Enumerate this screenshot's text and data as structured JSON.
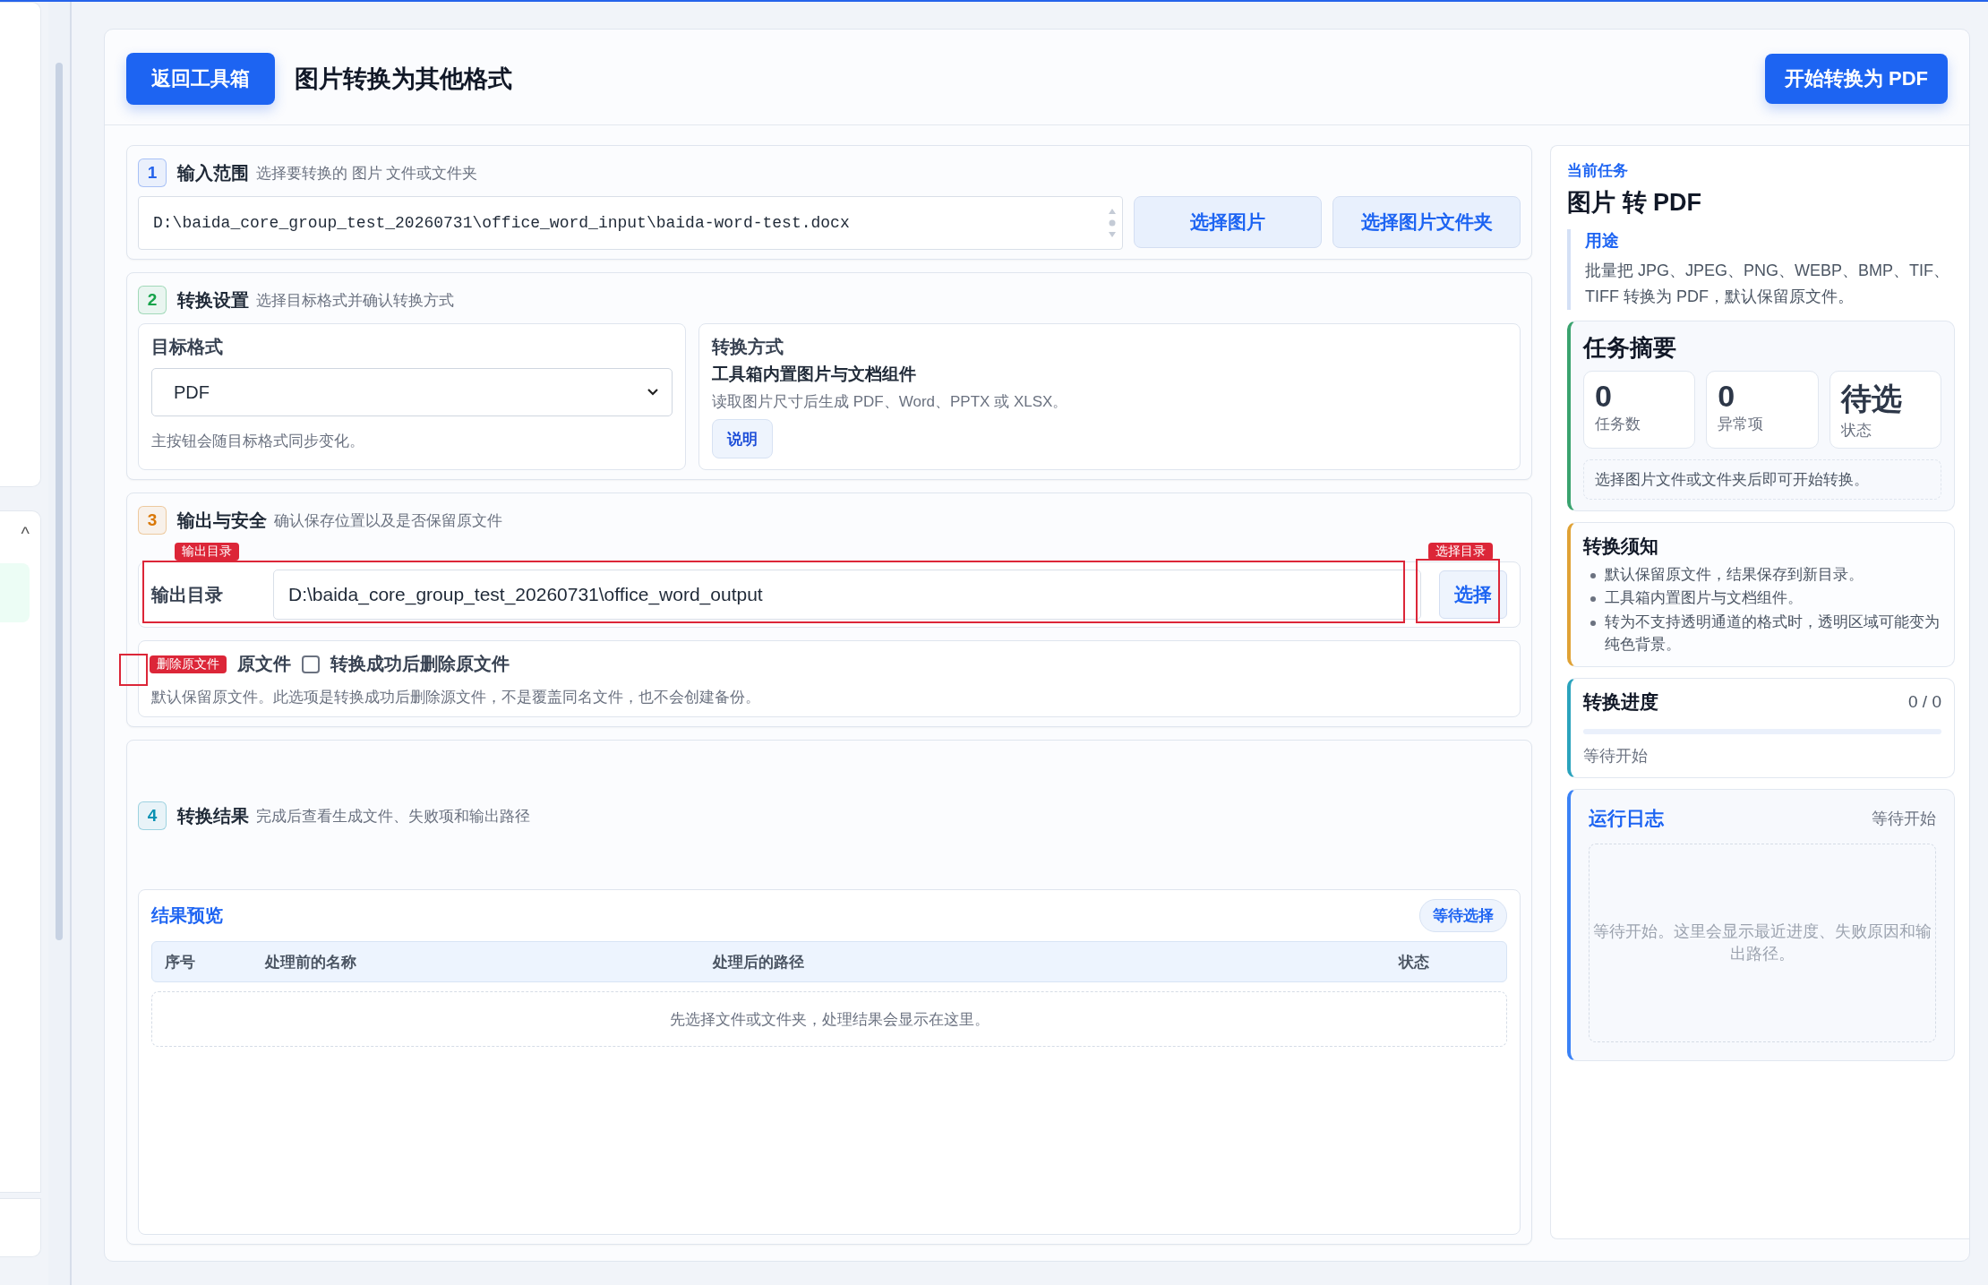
{
  "side_stub": {
    "toggle": "^"
  },
  "header": {
    "back_button": "返回工具箱",
    "title": "图片转换为其他格式",
    "start_button": "开始转换为 PDF"
  },
  "sections": [
    {
      "kind": "input",
      "number": "1",
      "color": "#2563eb",
      "title": "输入范围",
      "hint": "选择要转换的 图片 文件或文件夹",
      "path": "D:\\baida_core_group_test_20260731\\office_word_input\\baida-word-test.docx",
      "buttons": [
        "选择图片",
        "选择图片文件夹"
      ]
    },
    {
      "kind": "settings",
      "number": "2",
      "color": "#16a34a",
      "title": "转换设置",
      "hint": "选择目标格式并确认转换方式",
      "target": {
        "label": "目标格式",
        "value": "PDF",
        "note": "主按钮会随目标格式同步变化。"
      },
      "method": {
        "label": "转换方式",
        "name": "工具箱内置图片与文档组件",
        "description": "读取图片尺寸后生成 PDF、Word、PPTX 或 XLSX。",
        "help_button": "说明"
      }
    },
    {
      "kind": "output",
      "number": "3",
      "color": "#d97706",
      "title": "输出与安全",
      "hint": "确认保存位置以及是否保留原文件",
      "output_dir": {
        "label": "输出目录",
        "value": "D:\\baida_core_group_test_20260731\\office_word_output",
        "annotation": "输出目录"
      },
      "choose_button": {
        "label": "选择",
        "annotation": "选择目录"
      },
      "delete_option": {
        "prefix": "原文件",
        "label": "转换成功后删除原文件",
        "checked": false,
        "annotation": "删除原文件",
        "note": "默认保留原文件。此选项是转换成功后删除源文件，不是覆盖同名文件，也不会创建备份。"
      }
    },
    {
      "kind": "results",
      "number": "4",
      "color": "#0891b2",
      "title": "转换结果",
      "hint": "完成后查看生成文件、失败项和输出路径",
      "preview": {
        "title": "结果预览",
        "badge": "等待选择",
        "columns": [
          "序号",
          "处理前的名称",
          "处理后的路径",
          "状态"
        ],
        "empty": "先选择文件或文件夹，处理结果会显示在这里。"
      }
    }
  ],
  "side_panel": {
    "current_task": {
      "label": "当前任务",
      "title": "图片 转 PDF",
      "usage_label": "用途",
      "usage_text": "批量把 JPG、JPEG、PNG、WEBP、BMP、TIF、TIFF 转换为 PDF，默认保留原文件。"
    },
    "summary": {
      "title": "任务摘要",
      "stats": [
        {
          "value": "0",
          "label": "任务数"
        },
        {
          "value": "0",
          "label": "异常项"
        },
        {
          "value": "待选",
          "label": "状态"
        }
      ],
      "note": "选择图片文件或文件夹后即可开始转换。"
    },
    "notice": {
      "title": "转换须知",
      "items": [
        "默认保留原文件，结果保存到新目录。",
        "工具箱内置图片与文档组件。",
        "转为不支持透明通道的格式时，透明区域可能变为纯色背景。"
      ]
    },
    "progress": {
      "title": "转换进度",
      "count": "0 / 0",
      "level": 0,
      "status": "等待开始"
    },
    "log": {
      "title": "运行日志",
      "status": "等待开始",
      "placeholder": "等待开始。这里会显示最近进度、失败原因和输出路径。"
    }
  }
}
